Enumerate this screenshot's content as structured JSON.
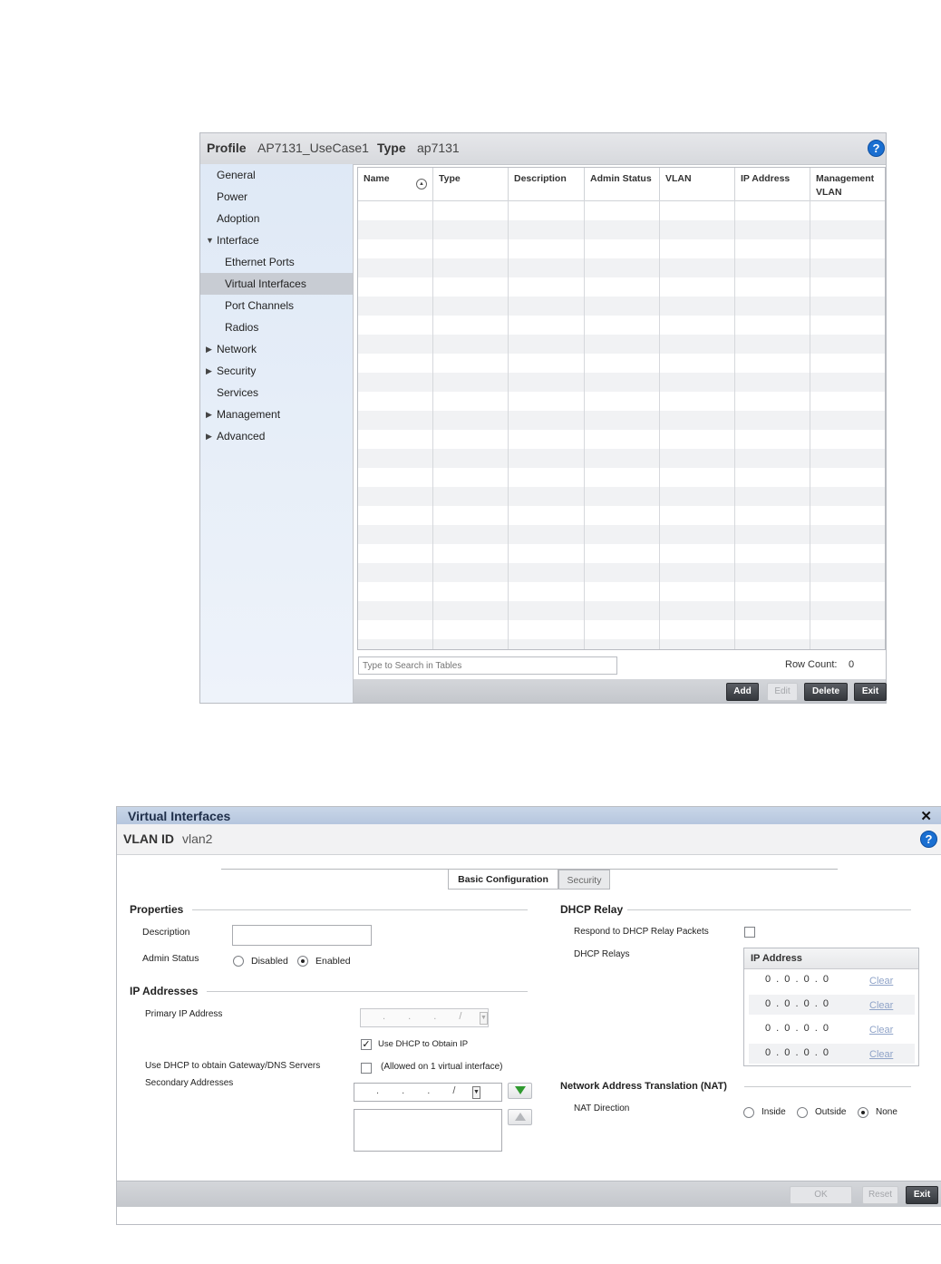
{
  "profile_panel": {
    "profile_label": "Profile",
    "profile_value": "AP7131_UseCase1",
    "type_label": "Type",
    "type_value": "ap7131",
    "help_glyph": "?",
    "nav": {
      "general": "General",
      "power": "Power",
      "adoption": "Adoption",
      "interface": "Interface",
      "ethernet_ports": "Ethernet Ports",
      "virtual_interfaces": "Virtual Interfaces",
      "port_channels": "Port Channels",
      "radios": "Radios",
      "network": "Network",
      "security": "Security",
      "services": "Services",
      "management": "Management",
      "advanced": "Advanced"
    },
    "table": {
      "columns": [
        "Name",
        "Type",
        "Description",
        "Admin Status",
        "VLAN",
        "IP Address",
        "Management VLAN"
      ],
      "rows": []
    },
    "search_placeholder": "Type to Search in Tables",
    "row_count_label": "Row Count:",
    "row_count_value": "0",
    "buttons": {
      "add": "Add",
      "edit": "Edit",
      "delete": "Delete",
      "exit": "Exit"
    }
  },
  "vi_dialog": {
    "title": "Virtual Interfaces",
    "close_glyph": "✕",
    "vlan_label": "VLAN ID",
    "vlan_value": "vlan2",
    "help_glyph": "?",
    "tabs": {
      "basic": "Basic Configuration",
      "security": "Security"
    },
    "properties": {
      "heading": "Properties",
      "description_label": "Description",
      "description_value": "",
      "admin_status_label": "Admin Status",
      "disabled_label": "Disabled",
      "enabled_label": "Enabled",
      "admin_status_selected": "Enabled"
    },
    "ip_addresses": {
      "heading": "IP Addresses",
      "primary_label": "Primary IP Address",
      "primary_value": ". . . /",
      "use_dhcp_label": "Use DHCP to Obtain IP",
      "use_dhcp_checked": true,
      "gw_dns_label": "Use DHCP to obtain Gateway/DNS Servers",
      "gw_dns_note": "(Allowed on 1 virtual interface)",
      "gw_dns_checked": false,
      "secondary_label": "Secondary Addresses",
      "secondary_value": ". . . /"
    },
    "dhcp_relay": {
      "heading": "DHCP Relay",
      "respond_label": "Respond to DHCP Relay Packets",
      "respond_checked": false,
      "relays_label": "DHCP Relays",
      "ip_column": "IP Address",
      "clear_label": "Clear",
      "relays": [
        "0 . 0 . 0 . 0",
        "0 . 0 . 0 . 0",
        "0 . 0 . 0 . 0",
        "0 . 0 . 0 . 0"
      ]
    },
    "nat": {
      "heading": "Network Address Translation (NAT)",
      "direction_label": "NAT Direction",
      "inside_label": "Inside",
      "outside_label": "Outside",
      "none_label": "None",
      "selected": "None"
    },
    "buttons": {
      "ok": "OK",
      "reset": "Reset",
      "exit": "Exit"
    }
  }
}
